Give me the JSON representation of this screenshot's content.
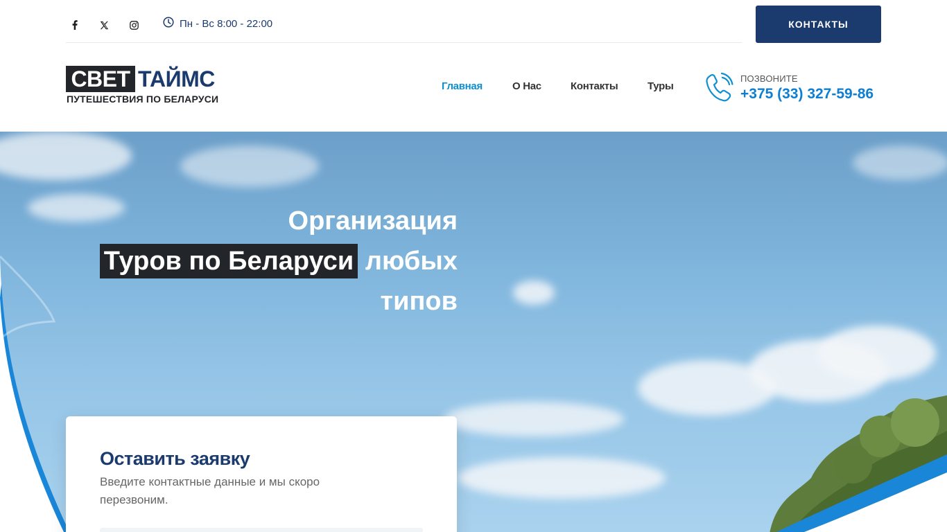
{
  "header": {
    "social": [
      {
        "name": "facebook-icon"
      },
      {
        "name": "x-twitter-icon"
      },
      {
        "name": "instagram-icon"
      }
    ],
    "hours": "Пн - Вс 8:00 - 22:00",
    "contacts_button": "КОНТАКТЫ"
  },
  "logo": {
    "word1": "СВЕТ",
    "word2": "ТАЙМС",
    "subtitle": "ПУТЕШЕСТВИЯ ПО БЕЛАРУСИ"
  },
  "nav": {
    "items": [
      "Главная",
      "О Нас",
      "Контакты",
      "Туры"
    ],
    "active": "Главная"
  },
  "call": {
    "label": "ПОЗВОНИТЕ",
    "number": "+375 (33) 327-59-86"
  },
  "hero": {
    "line1": "Организация",
    "highlight": "Туров по Беларуси",
    "line2_rest": "любых",
    "line3": "типов"
  },
  "form": {
    "title": "Оставить заявку",
    "subtitle": "Введите контактные данные и мы скоро перезвоним."
  },
  "colors": {
    "brand_navy": "#1b3b6f",
    "accent_blue": "#0e8fd0",
    "highlight_dark": "#222529"
  }
}
